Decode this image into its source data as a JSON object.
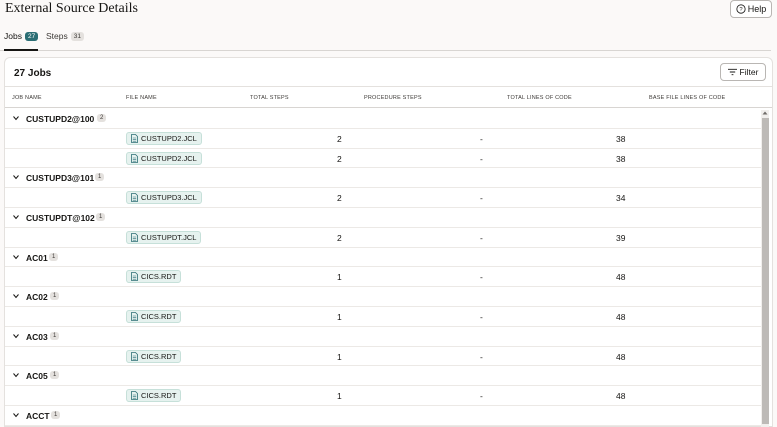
{
  "page": {
    "title": "External Source Details",
    "help_label": "Help"
  },
  "tabs": [
    {
      "label": "Jobs",
      "count": "27"
    },
    {
      "label": "Steps",
      "count": "31"
    }
  ],
  "card": {
    "title": "27 Jobs",
    "filter_label": "Filter"
  },
  "columns": [
    "JOB NAME",
    "FILE NAME",
    "TOTAL STEPS",
    "PROCEDURE STEPS",
    "TOTAL LINES OF CODE",
    "BASE FILE LINES OF CODE"
  ],
  "groups": [
    {
      "name": "CUSTUPD2@100",
      "count": "2",
      "files": [
        {
          "file": "CUSTUPD2.JCL",
          "total_steps": "2",
          "procedure_steps": "-",
          "total_lines": "38"
        },
        {
          "file": "CUSTUPD2.JCL",
          "total_steps": "2",
          "procedure_steps": "-",
          "total_lines": "38"
        }
      ]
    },
    {
      "name": "CUSTUPD3@101",
      "count": "1",
      "files": [
        {
          "file": "CUSTUPD3.JCL",
          "total_steps": "2",
          "procedure_steps": "-",
          "total_lines": "34"
        }
      ]
    },
    {
      "name": "CUSTUPDT@102",
      "count": "1",
      "files": [
        {
          "file": "CUSTUPDT.JCL",
          "total_steps": "2",
          "procedure_steps": "-",
          "total_lines": "39"
        }
      ]
    },
    {
      "name": "AC01",
      "count": "1",
      "files": [
        {
          "file": "CICS.RDT",
          "total_steps": "1",
          "procedure_steps": "-",
          "total_lines": "48"
        }
      ]
    },
    {
      "name": "AC02",
      "count": "1",
      "files": [
        {
          "file": "CICS.RDT",
          "total_steps": "1",
          "procedure_steps": "-",
          "total_lines": "48"
        }
      ]
    },
    {
      "name": "AC03",
      "count": "1",
      "files": [
        {
          "file": "CICS.RDT",
          "total_steps": "1",
          "procedure_steps": "-",
          "total_lines": "48"
        }
      ]
    },
    {
      "name": "AC05",
      "count": "1",
      "files": [
        {
          "file": "CICS.RDT",
          "total_steps": "1",
          "procedure_steps": "-",
          "total_lines": "48"
        }
      ]
    },
    {
      "name": "ACCT",
      "count": "1",
      "files": []
    }
  ],
  "icons": {
    "help": "help-circle-icon",
    "filter": "filter-lines-icon",
    "expand": "chevron-down-icon",
    "file": "document-icon"
  },
  "colors": {
    "accent": "#2b6e74",
    "file_tag_bg": "#e6f2ef",
    "background": "#fbf9f8"
  }
}
